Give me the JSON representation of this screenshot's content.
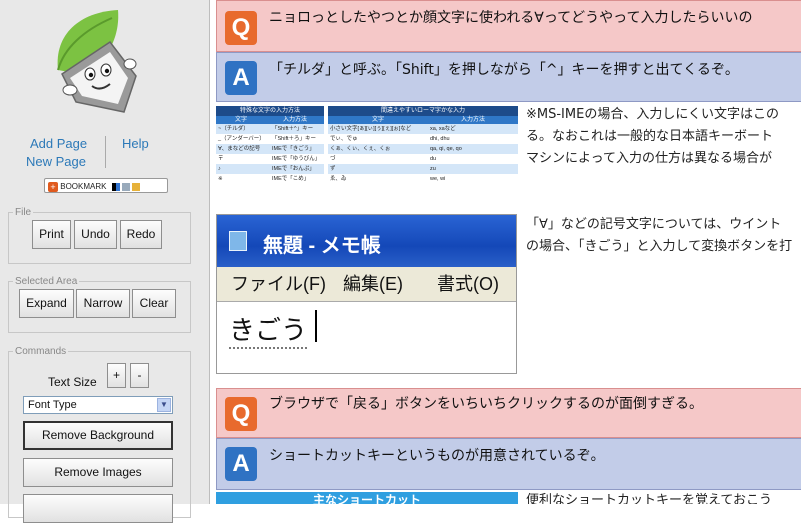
{
  "sidebar": {
    "links": {
      "add_page": "Add Page",
      "help": "Help",
      "new_page": "New Page"
    },
    "bookmark_label": "BOOKMARK",
    "file_group": {
      "legend": "File",
      "print": "Print",
      "undo": "Undo",
      "redo": "Redo"
    },
    "selected_area_group": {
      "legend": "Selected Area",
      "expand": "Expand",
      "narrow": "Narrow",
      "clear": "Clear"
    },
    "commands_group": {
      "legend": "Commands",
      "text_size_label": "Text Size",
      "plus": "+",
      "minus": "-",
      "font_type_selected": "Font Type",
      "remove_background": "Remove Background",
      "remove_images": "Remove Images"
    }
  },
  "content": {
    "qa": [
      {
        "badge": "Q",
        "text": "ニョロっとしたやつとか顔文字に使われる∀ってどうやって入力したらいいの"
      },
      {
        "badge": "A",
        "text": "「チルダ」と呼ぶ。「Shift」を押しながら「^」キーを押すと出てくるぞ。"
      },
      {
        "badge": "Q",
        "text": "ブラウザで「戻る」ボタンをいちいちクリックするのが面倒すぎる。"
      },
      {
        "badge": "A",
        "text": "ショートカットキーというものが用意されているぞ。"
      }
    ],
    "note1": {
      "line1": "※MS-IMEの場合、入力しにくい文字はこの",
      "line2": "る。なおこれは一般的な日本語キーボート",
      "line3": "マシンによって入力の仕方は異なる場合が"
    },
    "note2": {
      "line1": "「∀」などの記号文字については、ウイント",
      "line2": "の場合、「きごう」と入力して変換ボタンを打"
    },
    "note3": "便利なショートカットキーを覚えておこう",
    "table": {
      "left_header": "特殊な文字の入力方法",
      "right_header": "間違えやすいローマ字かな入力",
      "left_sub": [
        "文字",
        "入力方法"
      ],
      "right_sub": [
        "文字",
        "入力方法"
      ],
      "left_rows": [
        [
          "~（チルダ）",
          "「Shift＋^」キー"
        ],
        [
          "_（アンダーバー）",
          "「Shift＋ろ」キー"
        ],
        [
          "∀、まなどの記号",
          "IMEで「きごう」"
        ],
        [
          "〒",
          "IMEで「ゆうびん」"
        ],
        [
          "♪",
          "IMEで「おんぷ」"
        ],
        [
          "※",
          "IMEで「こめ」"
        ]
      ],
      "right_rows": [
        [
          "小さい文字[ぁ][ぃ][ぅ][ぇ][ぉ]など",
          "xa, xaなど"
        ],
        [
          "でぃ、でゅ",
          "dhi, dhu"
        ],
        [
          "くぁ、くぃ、くぇ、くぉ",
          "qa, qi, qe, qo"
        ],
        [
          "づ",
          "du"
        ],
        [
          "ず",
          "zu"
        ],
        [
          "ゑ、ゐ",
          "we, wi"
        ]
      ]
    },
    "notepad": {
      "title": "無題 - メモ帳",
      "menu": [
        "ファイル(F)",
        "編集(E)",
        "書式(O)"
      ],
      "text": "きごう"
    },
    "shortcut_table_header": "主なショートカット"
  },
  "colors": {
    "q_row_bg": "#f5c8c8",
    "a_row_bg": "#c2cce8",
    "q_badge": "#e86a2d",
    "a_badge": "#2f72c3",
    "link": "#2c79b8"
  }
}
